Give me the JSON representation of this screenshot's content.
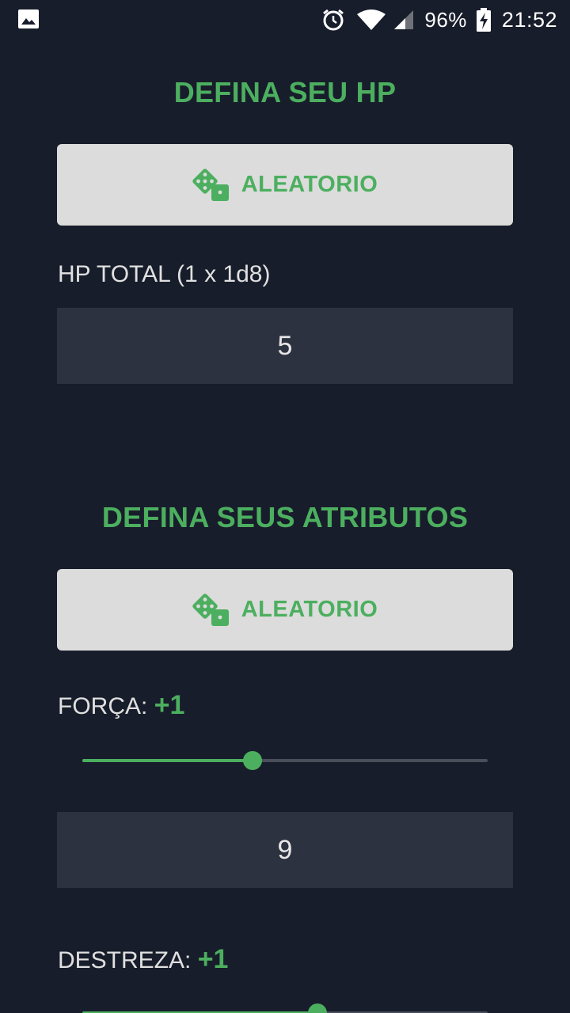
{
  "status_bar": {
    "battery": "96%",
    "time": "21:52",
    "icons": [
      "image-icon",
      "alarm-icon",
      "wifi-icon",
      "signal-icon",
      "battery-charging-icon"
    ]
  },
  "hp_section": {
    "title": "DEFINA SEU HP",
    "random_button": "ALEATORIO",
    "total_label": "HP TOTAL (1 x 1d8)",
    "total_value": "5"
  },
  "attributes_section": {
    "title": "DEFINA SEUS ATRIBUTOS",
    "random_button": "ALEATORIO",
    "attributes": [
      {
        "label": "FORÇA: ",
        "modifier": "+1",
        "value": "9",
        "slider_fraction": 0.42
      },
      {
        "label": "DESTREZA: ",
        "modifier": "+1",
        "slider_fraction": 0.58
      }
    ]
  },
  "colors": {
    "background": "#181d2b",
    "accent": "#4caf5f",
    "button_bg": "#dcdcdc",
    "input_bg": "#2d3240"
  }
}
